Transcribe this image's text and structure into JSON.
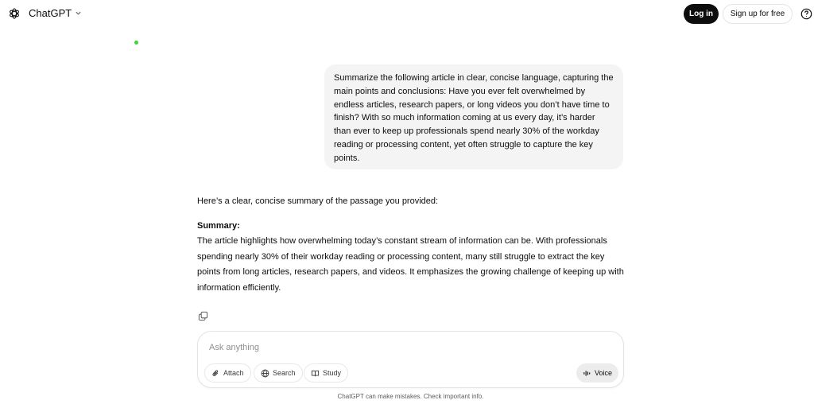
{
  "header": {
    "brand": "ChatGPT",
    "login_label": "Log in",
    "signup_label": "Sign up for free"
  },
  "conversation": {
    "user_message": "Summarize the following article in clear, concise language, capturing the main points and conclusions: Have you ever felt overwhelmed by endless articles, research papers, or long videos you don’t have time to finish? With so much information coming at us every day, it’s harder than ever to keep up professionals spend nearly 30% of the workday reading or processing content, yet often struggle to capture the key points.",
    "assistant_intro": "Here’s a clear, concise summary of the passage you provided:",
    "assistant_heading": "Summary:",
    "assistant_body": "The article highlights how overwhelming today’s constant stream of information can be. With professionals spending nearly 30% of their workday reading or processing content, many still struggle to extract the key points from long articles, research papers, and videos. It emphasizes the growing challenge of keeping up with information efficiently."
  },
  "composer": {
    "placeholder": "Ask anything",
    "attach_label": "Attach",
    "search_label": "Search",
    "study_label": "Study",
    "voice_label": "Voice"
  },
  "footer": {
    "disclaimer": "ChatGPT can make mistakes. Check important info."
  },
  "colors": {
    "status_dot": "#3cd63c",
    "user_bubble_bg": "#f4f4f4",
    "primary_button_bg": "#0d0d0d"
  }
}
